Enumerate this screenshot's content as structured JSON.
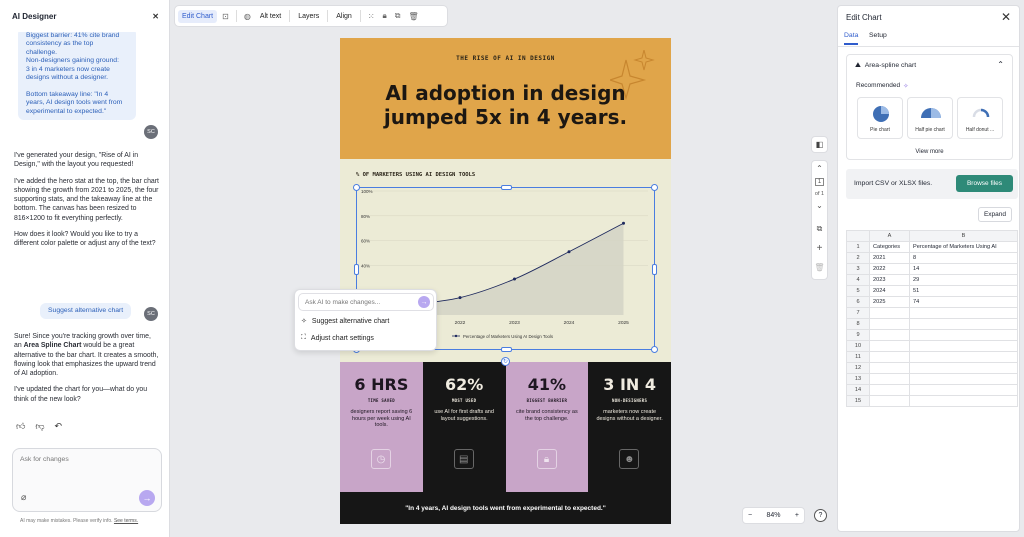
{
  "left_panel": {
    "title": "AI Designer",
    "msg1_lines": [
      "Biggest barrier: 41% cite brand",
      "consistency as the top",
      "challenge.",
      "Non-designers gaining ground:",
      "3 in 4 marketers now create",
      "designs without a designer.",
      "",
      "Bottom takeaway line: \"In 4",
      "years, AI design tools went from",
      "experimental to expected.\""
    ],
    "avatar": "SC",
    "ai1": [
      "I've generated your design, \"Rise of AI in Design,\" with the layout you requested!",
      "I've added the hero stat at the top, the bar chart showing the growth from 2021 to 2025, the four supporting stats, and the takeaway line at the bottom. The canvas has been resized to 816×1200 to fit everything perfectly.",
      "How does it look? Would you like to try a different color palette or adjust any of the text?"
    ],
    "user2": "Suggest alternative chart",
    "ai2_pre": "Sure! Since you're tracking growth over time, an ",
    "ai2_bold": "Area Spline Chart",
    "ai2_post": " would be a great alternative to the bar chart. It creates a smooth, flowing look that emphasizes the upward trend of AI adoption.",
    "ai3": "I've updated the chart for you—what do you think of the new look?",
    "input_placeholder": "Ask for changes",
    "disclaimer": "AI may make mistakes. Please verify info.",
    "terms": "See terms."
  },
  "toolbar": {
    "edit_chart": "Edit Chart",
    "alt_text": "Alt text",
    "layers": "Layers",
    "align": "Align"
  },
  "poster": {
    "kicker": "THE RISE OF AI IN DESIGN",
    "title_l1": "AI adoption in design",
    "title_l2": "jumped 5x in 4 years.",
    "chart_title": "% OF MARKETERS USING AI DESIGN TOOLS",
    "stats": [
      {
        "big": "6 HRS",
        "label": "TIME SAVED",
        "desc": "designers report saving 6 hours per week using AI tools."
      },
      {
        "big": "62%",
        "label": "MOST USED",
        "desc": "use AI for first drafts and layout suggestions."
      },
      {
        "big": "41%",
        "label": "BIGGEST BARRIER",
        "desc": "cite brand consistency as the top challenge."
      },
      {
        "big": "3 IN 4",
        "label": "NON-DESIGNERS",
        "desc": "marketers now create designs without a designer."
      }
    ],
    "quote": "\"In 4 years, AI design tools went from experimental to expected.\""
  },
  "chart_data": {
    "type": "area",
    "categories": [
      "2021",
      "2022",
      "2023",
      "2024",
      "2025"
    ],
    "series": [
      {
        "name": "Percentage of Marketers Using AI Design Tools",
        "values": [
          8,
          14,
          29,
          51,
          74
        ]
      }
    ],
    "title": "% OF MARKETERS USING AI DESIGN TOOLS",
    "y_ticks": [
      "100%",
      "80%",
      "60%",
      "40%"
    ],
    "ylim": [
      0,
      100
    ],
    "legend": "bottom",
    "color": "#1f2a5e"
  },
  "popup": {
    "placeholder": "Ask AI to make changes...",
    "item1": "Suggest alternative chart",
    "item2": "Adjust chart settings"
  },
  "pager": {
    "page": "1",
    "of": "of 1"
  },
  "zoom": {
    "minus": "−",
    "value": "84%",
    "plus": "+"
  },
  "right_panel": {
    "title": "Edit Chart",
    "tab_data": "Data",
    "tab_setup": "Setup",
    "chart_type": "Area-spline chart",
    "recommended": "Recommended",
    "cards": [
      "Pie chart",
      "Half pie chart",
      "Half donut ..."
    ],
    "view_more": "View more",
    "import_text": "Import CSV or XLSX files.",
    "browse": "Browse files",
    "expand": "Expand",
    "col_a": "A",
    "col_b": "B",
    "rows": [
      [
        "Categories",
        "Percentage of Marketers Using AI"
      ],
      [
        "2021",
        "8"
      ],
      [
        "2022",
        "14"
      ],
      [
        "2023",
        "29"
      ],
      [
        "2024",
        "51"
      ],
      [
        "2025",
        "74"
      ],
      [
        "",
        ""
      ],
      [
        "",
        ""
      ],
      [
        "",
        ""
      ],
      [
        "",
        ""
      ],
      [
        "",
        ""
      ],
      [
        "",
        ""
      ],
      [
        "",
        ""
      ],
      [
        "",
        ""
      ],
      [
        "",
        ""
      ]
    ]
  }
}
